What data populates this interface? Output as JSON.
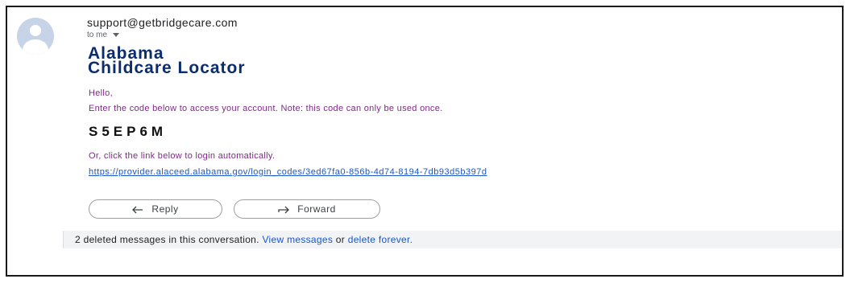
{
  "sender": {
    "email": "support@getbridgecare.com",
    "to_label": "to me"
  },
  "brand": {
    "line1": "Alabama",
    "line2": "Childcare Locator"
  },
  "body": {
    "greeting": "Hello,",
    "instruction": "Enter the code below to access your account. Note: this code can only be used once.",
    "code": "S5EP6M",
    "or_text": "Or, click the link below to login automatically.",
    "login_link": "https://provider.alaceed.alabama.gov/login_codes/3ed67fa0-856b-4d74-8194-7db93d5b397d"
  },
  "actions": {
    "reply_label": "Reply",
    "forward_label": "Forward"
  },
  "deleted_bar": {
    "text": "2 deleted messages in this conversation.",
    "view_link": "View messages",
    "or_word": "or",
    "delete_link": "delete forever."
  },
  "colors": {
    "brand": "#0c2d6b",
    "body_text": "#7d2a85",
    "link": "#1a55c9",
    "avatar": "#c7d3e7"
  }
}
